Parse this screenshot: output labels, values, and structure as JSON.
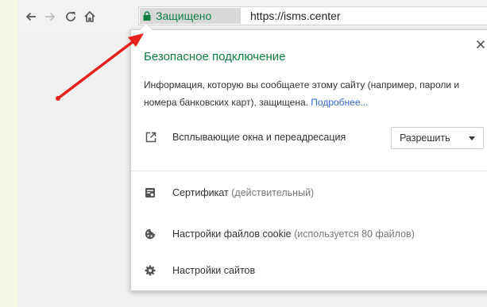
{
  "toolbar": {
    "back_icon": "arrow-left-icon",
    "forward_icon": "arrow-right-icon",
    "reload_icon": "reload-icon",
    "home_icon": "home-icon"
  },
  "omnibox": {
    "security_label": "Защищено",
    "url": "https://isms.center"
  },
  "popup": {
    "title": "Безопасное подключение",
    "description": "Информация, которую вы сообщаете этому сайту (например, пароли и номера банковских карт), защищена.",
    "more_link": "Подробнее...",
    "permission": {
      "label": "Всплывающие окна и переадресация",
      "value": "Разрешить"
    },
    "certificate": {
      "label": "Сертификат",
      "note": "(действительный)"
    },
    "cookies": {
      "label": "Настройки файлов cookie",
      "note": "(используется 80 файлов)"
    },
    "site_settings": {
      "label": "Настройки сайтов"
    }
  },
  "colors": {
    "secure_green": "#0b8043",
    "link_blue": "#3367d6",
    "annotation_red": "#e8211c"
  }
}
